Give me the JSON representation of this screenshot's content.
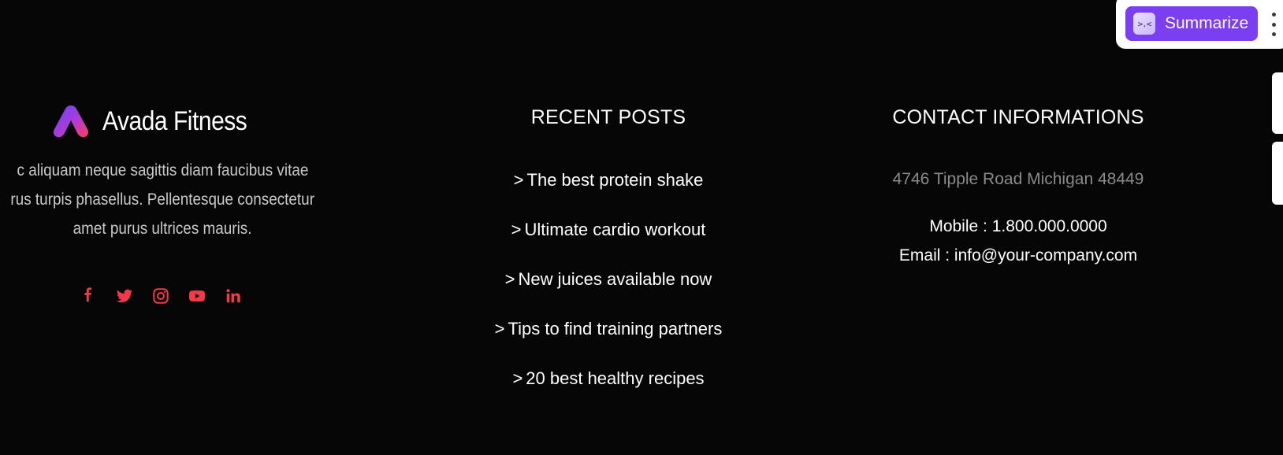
{
  "brand": {
    "name": "Avada Fitness",
    "about_lines": [
      "c aliquam neque sagittis diam faucibus vitae",
      "rus turpis phasellus. Pellentesque consectetur",
      "amet purus ultrices mauris."
    ]
  },
  "social": [
    {
      "icon": "facebook-icon"
    },
    {
      "icon": "twitter-icon"
    },
    {
      "icon": "instagram-icon"
    },
    {
      "icon": "youtube-icon"
    },
    {
      "icon": "linkedin-icon"
    }
  ],
  "colors": {
    "background": "#060606",
    "social_accent": "#f03a4a",
    "summarize_purple": "#7b3ef0",
    "address_gray": "#8a8a8a"
  },
  "posts": {
    "title": "RECENT POSTS",
    "chevron": ">",
    "items": [
      "The best protein shake",
      "Ultimate cardio workout",
      "New juices available now",
      "Tips to find training partners",
      "20 best healthy recipes"
    ]
  },
  "contact": {
    "title": "CONTACT INFORMATIONS",
    "address": "4746 Tipple Road Michigan 48449",
    "mobile": "Mobile : 1.800.000.0000",
    "email": "Email : info@your-company.com"
  },
  "widget": {
    "summarize_label": "Summarize",
    "icon_glyph": ">.<"
  }
}
